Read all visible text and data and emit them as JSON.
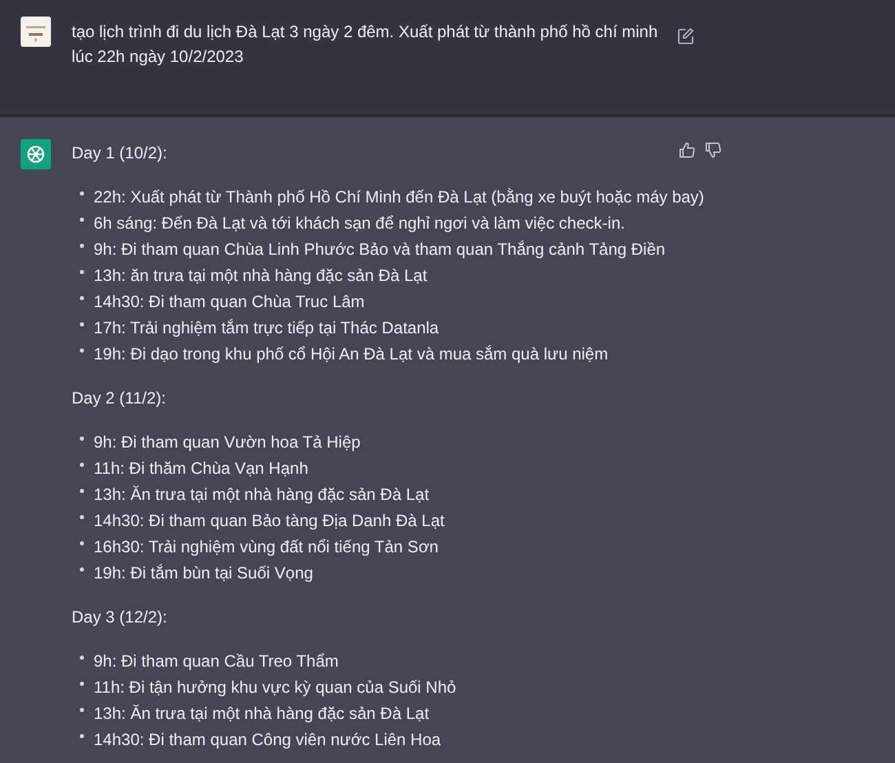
{
  "user_message": {
    "text": "tạo lịch trình đi du lịch Đà Lạt 3 ngày 2 đêm. Xuất phát từ thành phố hồ chí minh lúc 22h ngày 10/2/2023"
  },
  "assistant_message": {
    "days": [
      {
        "heading": "Day 1 (10/2):",
        "items": [
          "22h: Xuất phát từ Thành phố Hồ Chí Minh đến Đà Lạt (bằng xe buýt hoặc máy bay)",
          "6h sáng: Đến Đà Lạt và tới khách sạn để nghỉ ngơi và làm việc check-in.",
          "9h: Đi tham quan Chùa Linh Phước Bảo và tham quan Thắng cảnh Tảng Điền",
          "13h: ăn trưa tại một nhà hàng đặc sản Đà Lạt",
          "14h30: Đi tham quan Chùa Truc Lâm",
          "17h: Trải nghiệm tắm trực tiếp tại Thác Datanla",
          "19h: Đi dạo trong khu phố cổ Hội An Đà Lạt và mua sắm quà lưu niệm"
        ]
      },
      {
        "heading": "Day 2 (11/2):",
        "items": [
          "9h: Đi tham quan Vườn hoa Tả Hiệp",
          "11h: Đi thăm Chùa Vạn Hạnh",
          "13h: Ăn trưa tại một nhà hàng đặc sản Đà Lạt",
          "14h30: Đi tham quan Bảo tàng Địa Danh Đà Lạt",
          "16h30: Trải nghiệm vùng đất nổi tiếng Tản Sơn",
          "19h: Đi tắm bùn tại Suối Vọng"
        ]
      },
      {
        "heading": "Day 3 (12/2):",
        "items": [
          "9h: Đi tham quan Cầu Treo Thẩm",
          "11h: Đi tận hưởng khu vực kỳ quan của Suối Nhỏ",
          "13h: Ăn trưa tại một nhà hàng đặc sản Đà Lạt",
          "14h30: Đi tham quan Công viên nước Liên Hoa"
        ]
      }
    ]
  }
}
